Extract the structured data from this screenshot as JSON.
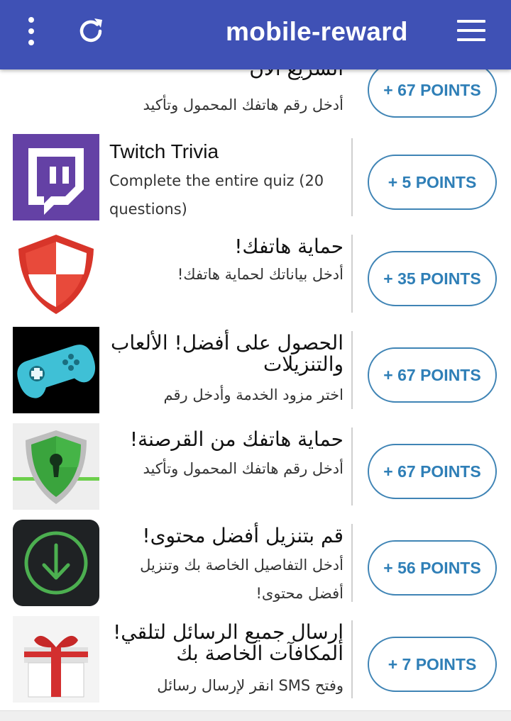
{
  "app_bar": {
    "title": "mobile-reward",
    "icons": [
      "more-vert-icon",
      "refresh-icon",
      "menu-icon"
    ],
    "color": "#3f51b5"
  },
  "offers": [
    {
      "title": "السريع الآن",
      "description": "أدخل رقم هاتفك المحمول وتأكيد",
      "points": "+ 67 POINTS",
      "icon": "soldier-game-icon"
    },
    {
      "title": "Twitch Trivia",
      "description": "Complete the entire quiz (20 questions)",
      "points": "+ 5 POINTS",
      "icon": "twitch-icon"
    },
    {
      "title": "حماية هاتفك!",
      "description": "أدخل بياناتك لحماية هاتفك!",
      "points": "+ 35 POINTS",
      "icon": "shield-icon"
    },
    {
      "title": "الحصول على أفضل! الألعاب والتنزيلات",
      "description": "اختر مزود الخدمة وأدخل رقم",
      "points": "+ 67 POINTS",
      "icon": "gamepad-icon"
    },
    {
      "title": "حماية هاتفك من القرصنة!",
      "description": "أدخل رقم هاتفك المحمول وتأكيد",
      "points": "+ 67 POINTS",
      "icon": "lock-shield-icon"
    },
    {
      "title": "قم بتنزيل أفضل محتوى!",
      "description": "أدخل التفاصيل الخاصة بك وتنزيل أفضل محتوى!",
      "points": "+ 56 POINTS",
      "icon": "download-icon"
    },
    {
      "title": "إرسال جميع الرسائل لتلقي! المكافآت الخاصة بك",
      "description": "وفتح SMS انقر لإرسال رسائل",
      "points": "+ 7 POINTS",
      "icon": "gift-box-icon"
    }
  ],
  "colors": {
    "accent": "#3f51b5",
    "button_text": "#2f7fb7",
    "twitch": "#6441a5",
    "game_bg": "#000000",
    "download_bg": "#1f2224"
  }
}
